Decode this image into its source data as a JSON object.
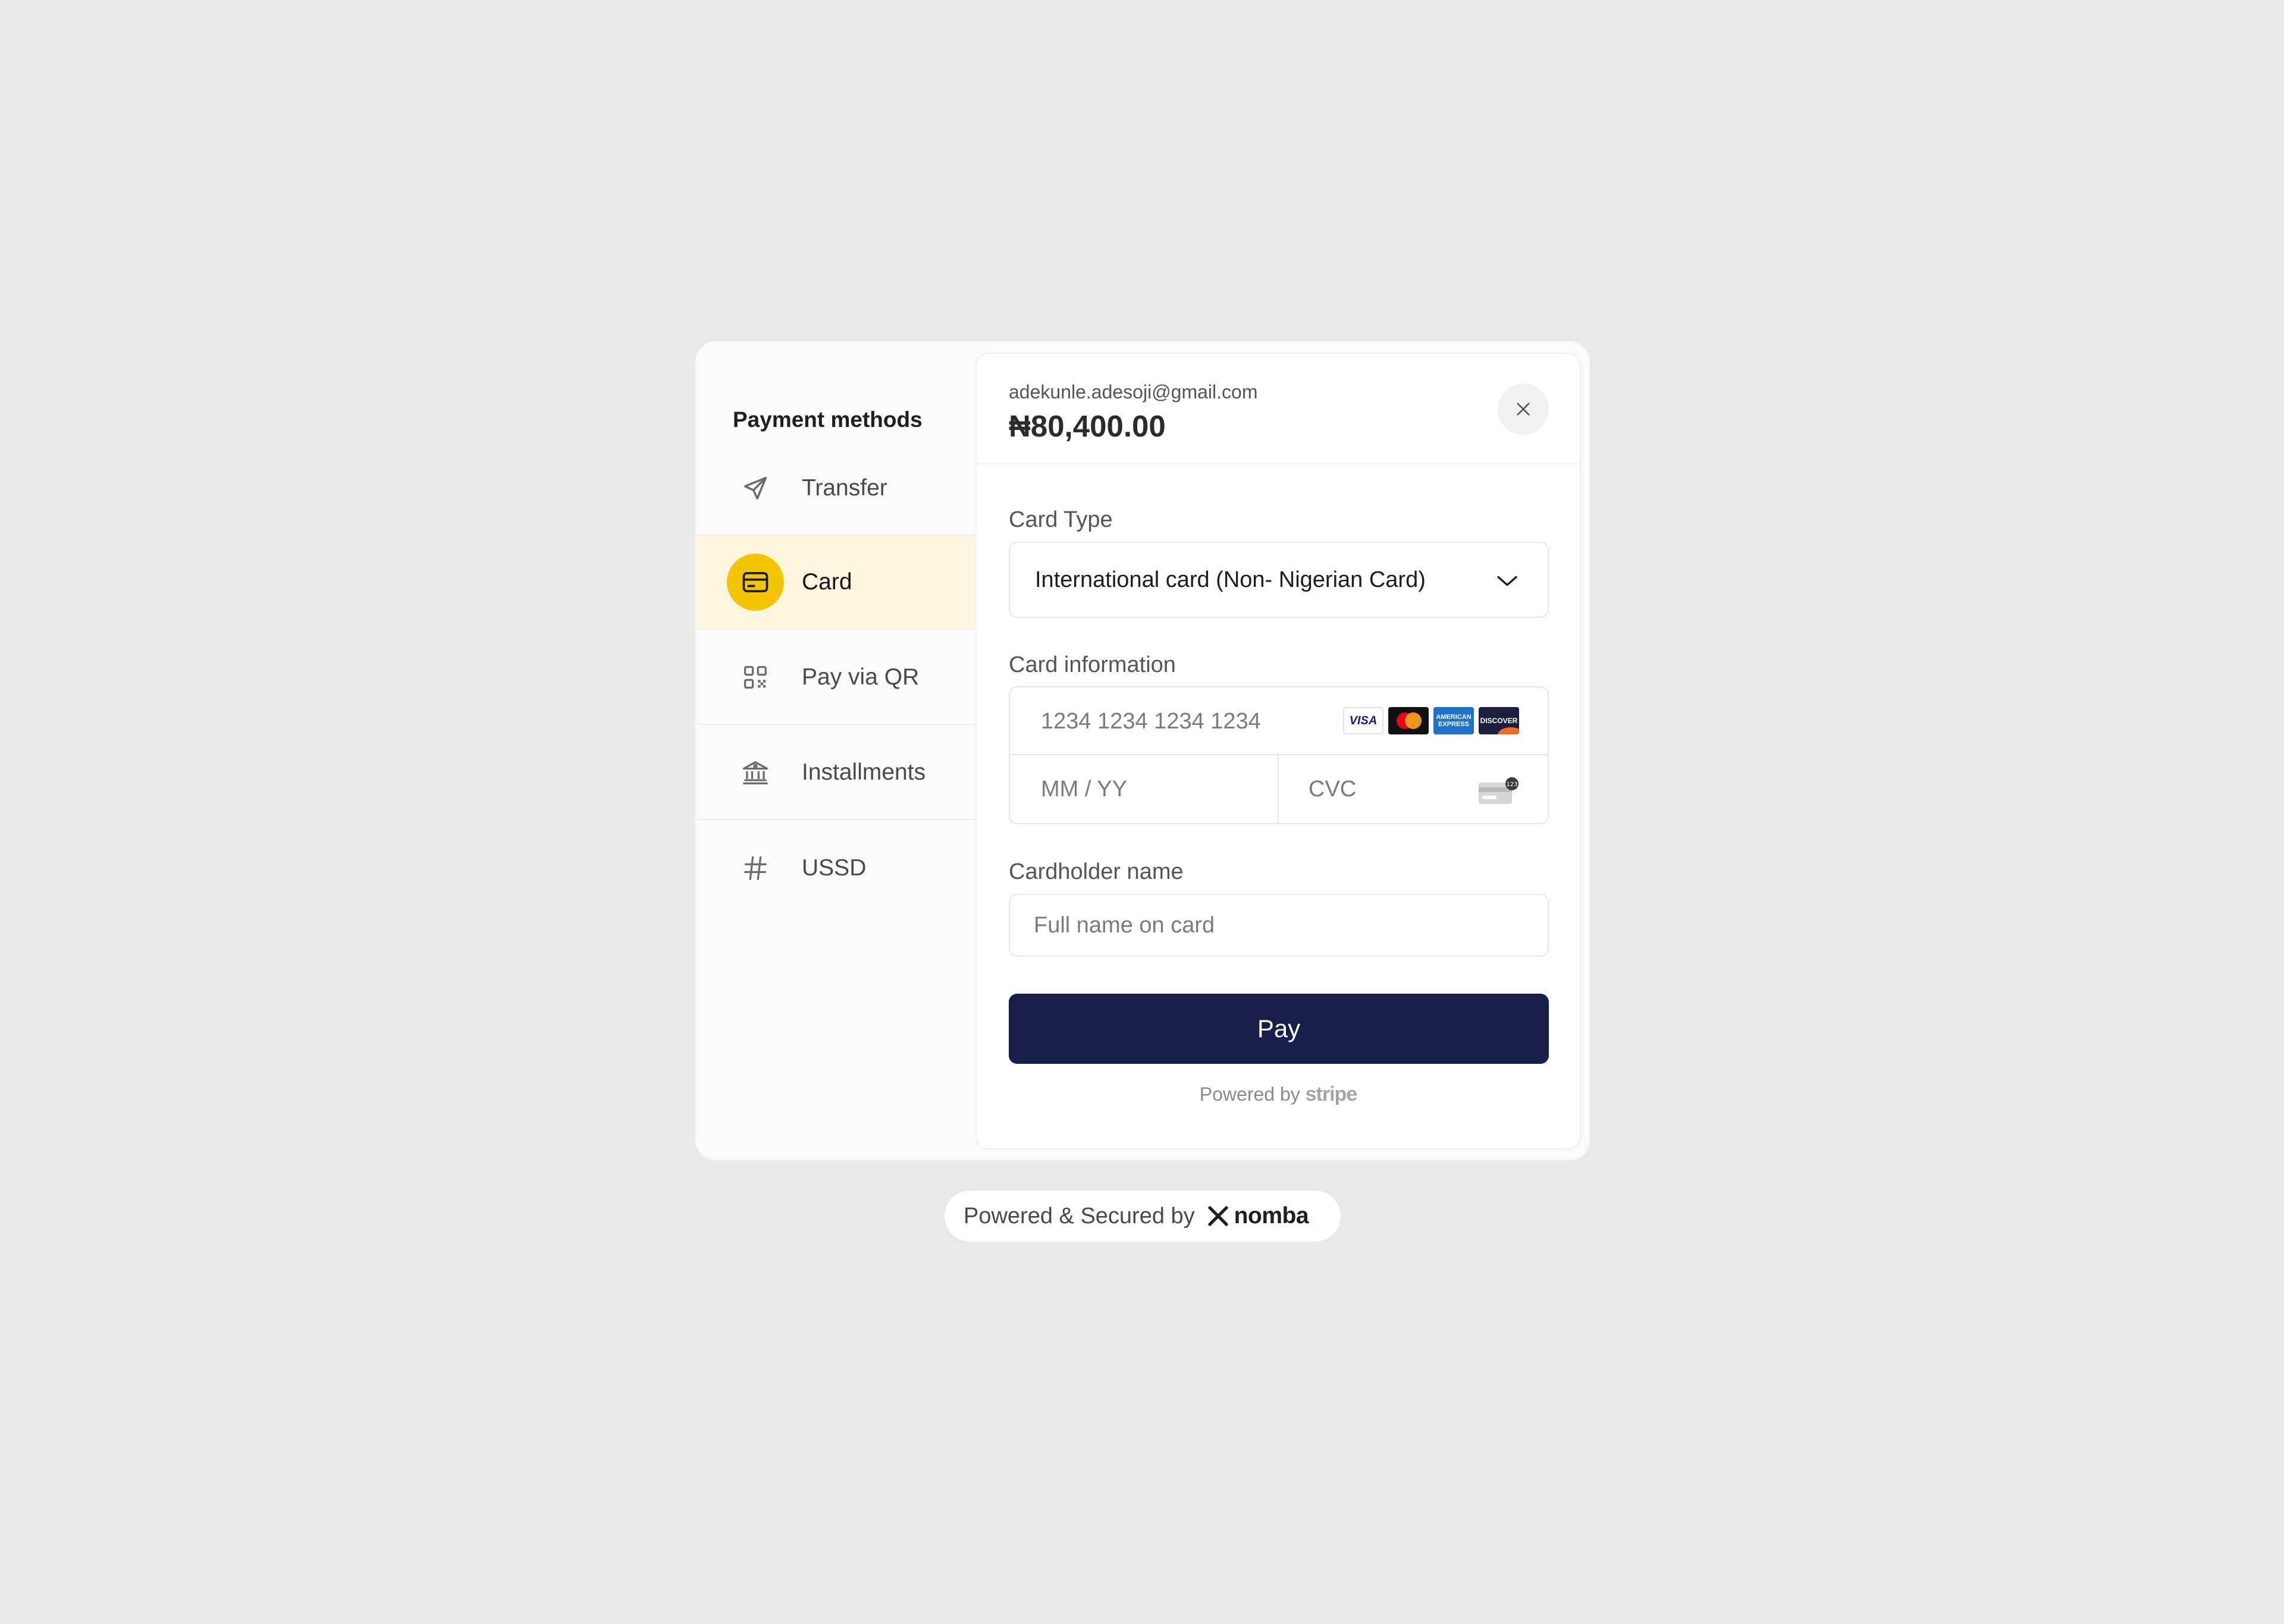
{
  "sidebar": {
    "title": "Payment methods",
    "items": [
      {
        "label": "Transfer",
        "icon": "send-icon"
      },
      {
        "label": "Card",
        "icon": "credit-card-icon",
        "active": true
      },
      {
        "label": "Pay via QR",
        "icon": "qr-code-icon"
      },
      {
        "label": "Installments",
        "icon": "bank-icon"
      },
      {
        "label": "USSD",
        "icon": "hash-icon"
      }
    ]
  },
  "header": {
    "email": "adekunle.adesoji@gmail.com",
    "amount": "₦80,400.00"
  },
  "form": {
    "card_type_label": "Card Type",
    "card_type_value": "International card (Non- Nigerian Card)",
    "card_info_label": "Card information",
    "card_number_placeholder": "1234 1234 1234 1234",
    "expiry_placeholder": "MM / YY",
    "cvc_placeholder": "CVC",
    "card_brands": [
      "VISA",
      "Mastercard",
      "American Express",
      "DISCOVER"
    ],
    "cardholder_label": "Cardholder name",
    "cardholder_placeholder": "Full name on card",
    "pay_label": "Pay",
    "powered_by": "Powered by",
    "powered_by_brand": "stripe"
  },
  "footer": {
    "text": "Powered & Secured by",
    "brand": "nomba"
  },
  "colors": {
    "accent_yellow": "#f5c400",
    "active_bg": "#fdf6df",
    "pay_button": "#172048",
    "page_bg": "#e8e8e8"
  }
}
